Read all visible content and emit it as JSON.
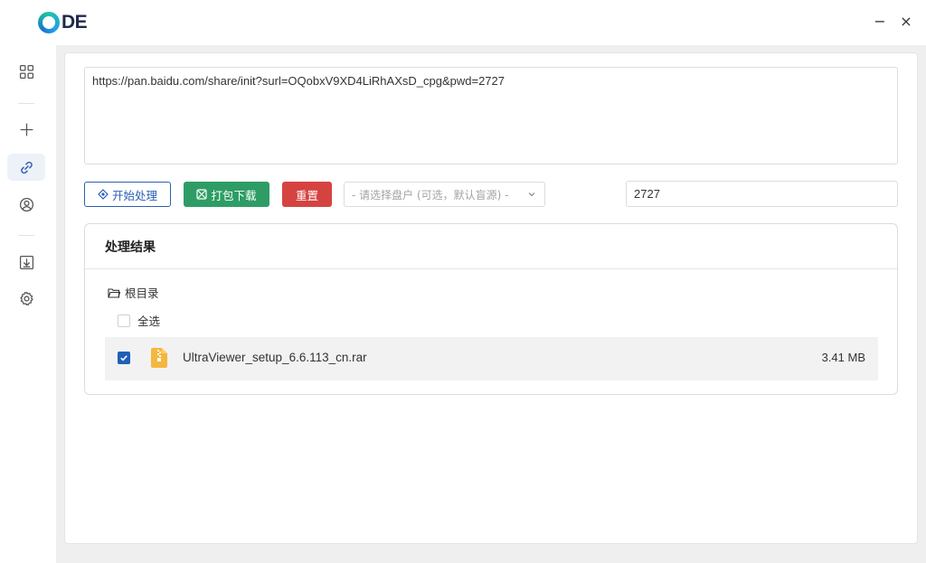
{
  "app": {
    "logo_text": "DE"
  },
  "window": {
    "minimize": "−",
    "close": "×"
  },
  "sidebar": {
    "items": [
      {
        "name": "dashboard",
        "icon": "grid-icon"
      },
      {
        "name": "add",
        "icon": "plus-icon"
      },
      {
        "name": "link",
        "icon": "link-icon",
        "active": true
      },
      {
        "name": "account",
        "icon": "user-circle-icon"
      },
      {
        "name": "downloads",
        "icon": "download-icon"
      },
      {
        "name": "settings",
        "icon": "gear-icon"
      }
    ]
  },
  "form": {
    "url_value": "https://pan.baidu.com/share/init?surl=OQobxV9XD4LiRhAXsD_cpg&pwd=2727",
    "start_label": "开始处理",
    "pack_label": "打包下载",
    "reset_label": "重置",
    "account_select_placeholder": "- 请选择盘户 (可选，默认盲源) -",
    "password_value": "2727"
  },
  "results": {
    "title": "处理结果",
    "root_label": "根目录",
    "select_all_label": "全选",
    "files": [
      {
        "name": "UltraViewer_setup_6.6.113_cn.rar",
        "size": "3.41 MB",
        "checked": true
      }
    ]
  },
  "colors": {
    "primary": "#2b5fb4",
    "success": "#2e9d65",
    "danger": "#d54340",
    "file_icon": "#f4b740"
  }
}
